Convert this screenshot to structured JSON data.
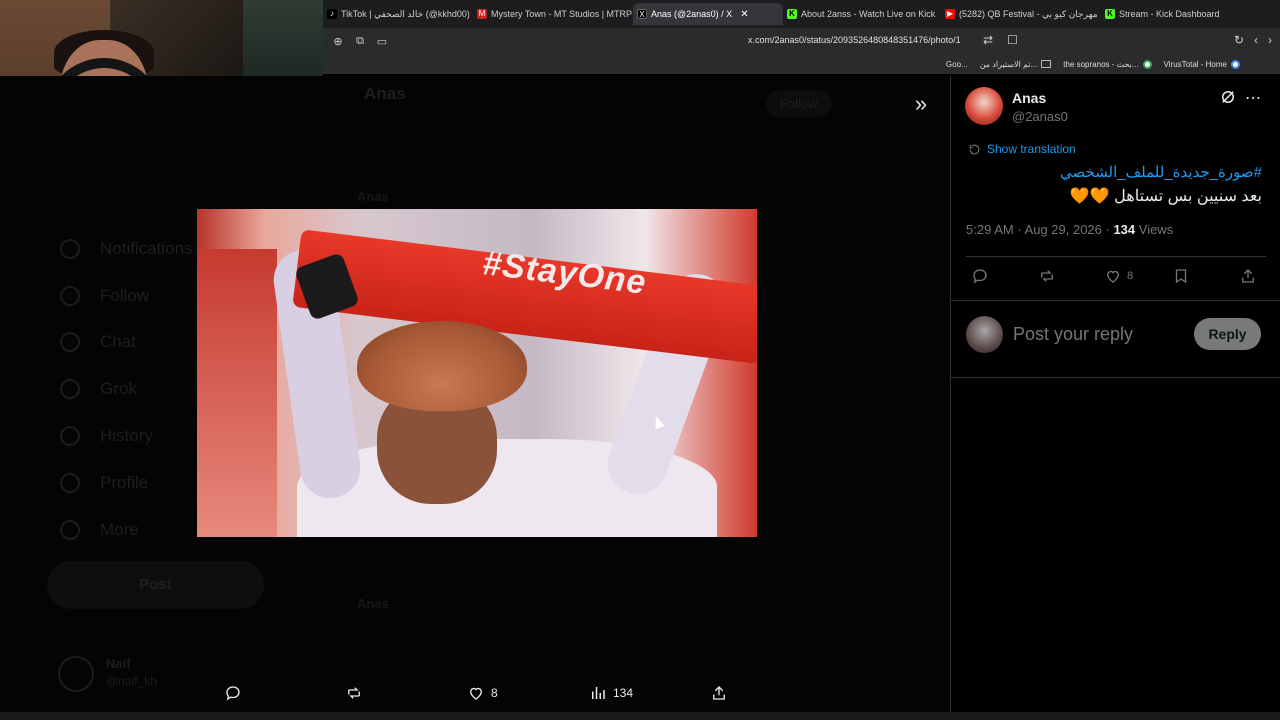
{
  "browser": {
    "tabs": [
      {
        "label": "TikTok | خالد الصحفي (@kkhd00)",
        "icon": "tiktok-icon",
        "active": false
      },
      {
        "label": "Mystery Town - MT Studios | MTRP",
        "icon": "mt-icon",
        "active": false
      },
      {
        "label": "Anas (@2anas0) / X",
        "icon": "x-icon",
        "active": true
      },
      {
        "label": "About 2anss - Watch Live on Kick",
        "icon": "kick-icon",
        "active": false
      },
      {
        "label": "(5282) QB Festival - مهرجان كيو بي",
        "icon": "youtube-icon",
        "active": false
      },
      {
        "label": "Stream - Kick Dashboard",
        "icon": "kick-icon",
        "active": false
      }
    ],
    "url": "x.com/2anas0/status/2093526480848351476/photo/1",
    "bookmarks": [
      {
        "label": "VirusTotal - Home",
        "icon": "virustotal-icon"
      },
      {
        "label": "the sopranos - بحث...",
        "icon": "google-icon"
      },
      {
        "label": "تم الاستيراد من...",
        "icon": "folder-icon"
      },
      {
        "label": "Goo...",
        "icon": "google-icon"
      }
    ]
  },
  "background_page": {
    "header_name": "Anas",
    "follow_label": "Follow",
    "nav_items": [
      "Notifications",
      "Follow",
      "Chat",
      "Grok",
      "History",
      "Profile",
      "More"
    ],
    "post_label": "Post",
    "user_name": "Naif",
    "user_handle": "@naif_kh"
  },
  "photo_viewer": {
    "scarf_text": "#StayOne",
    "actions": {
      "replies": "",
      "reposts": "",
      "likes": "8",
      "views": "134"
    }
  },
  "tweet": {
    "author_name": "Anas",
    "author_handle": "@2anas0",
    "show_translation": "Show translation",
    "hashtag": "#صورة_جديدة_للملف_الشخصي",
    "text": "بعد سنيين بس تستاهل 🧡🧡",
    "time": "5:29 AM · Aug 29, 2026 · ",
    "views_count": "134",
    "views_label": " Views",
    "likes_count": "8",
    "reply_placeholder": "Post your reply",
    "reply_button": "Reply"
  }
}
